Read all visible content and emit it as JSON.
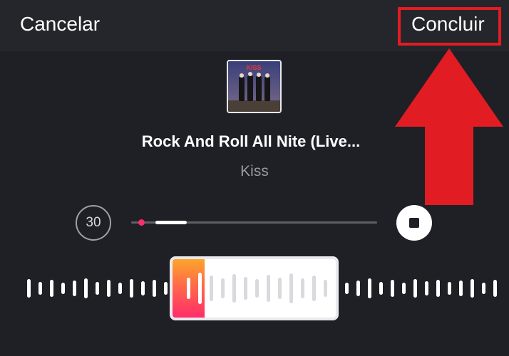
{
  "header": {
    "cancel_label": "Cancelar",
    "done_label": "Concluir"
  },
  "annotation": {
    "highlight_color": "#e21c23",
    "arrow_color": "#e21c23"
  },
  "song": {
    "title": "Rock And Roll All Nite (Live...",
    "artist": "Kiss",
    "album_art_icon": "album-cover",
    "album_art_text": "KISS"
  },
  "player": {
    "skip_label": "30",
    "progress_fraction": 0.22,
    "accent_color": "#ff2d6a",
    "stop_icon": "stop-icon"
  },
  "clip_selector": {
    "gradient_start": "#fca52a",
    "gradient_end": "#ff2d6a"
  }
}
